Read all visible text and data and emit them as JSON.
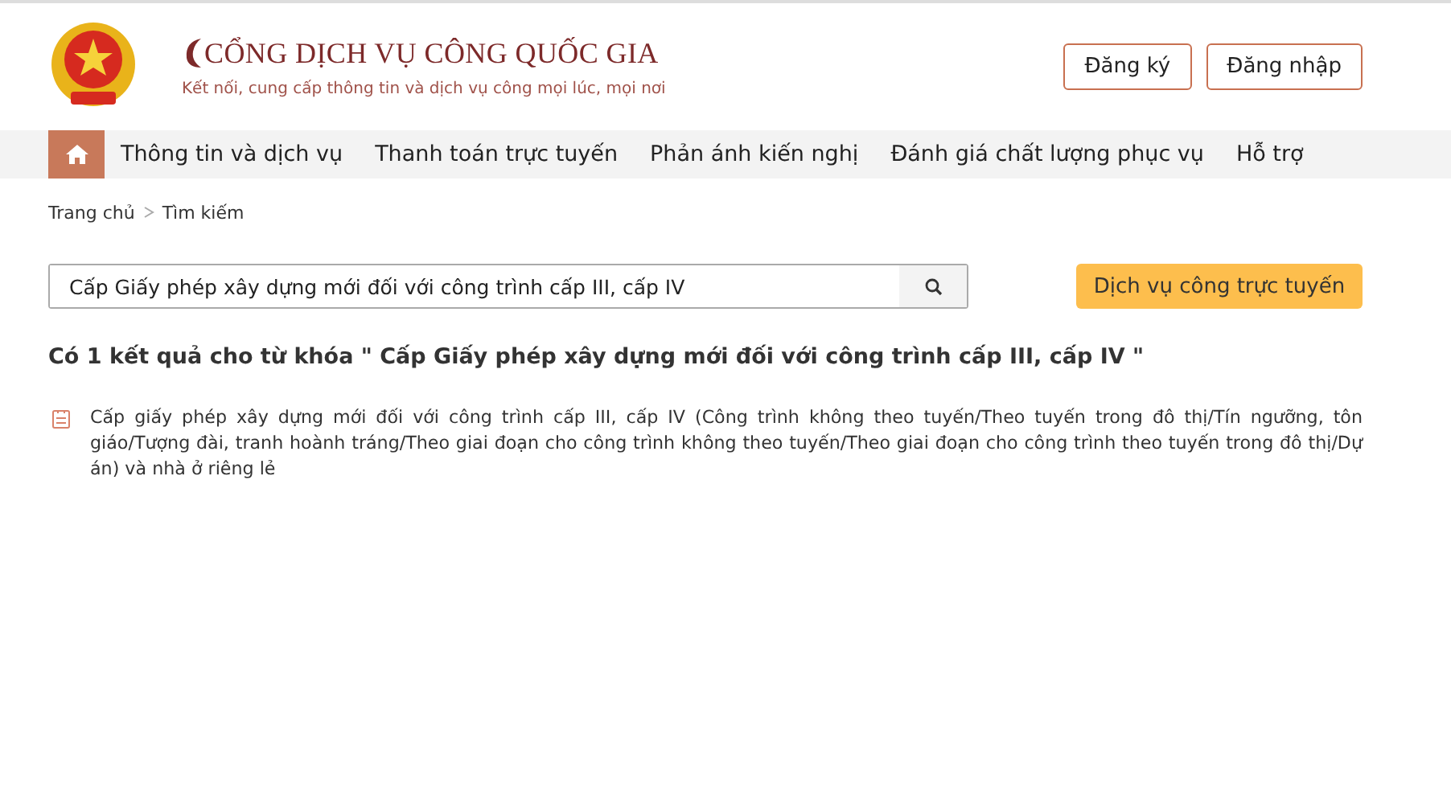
{
  "header": {
    "title": "CỔNG DỊCH VỤ CÔNG QUỐC GIA",
    "subtitle": "Kết nối, cung cấp thông tin và dịch vụ công mọi lúc, mọi nơi",
    "buttons": [
      "Đăng ký",
      "Đăng nhập"
    ]
  },
  "nav": {
    "items": [
      {
        "label": "Thông tin và dịch vụ"
      },
      {
        "label": "Thanh toán trực tuyến"
      },
      {
        "label": "Phản ánh kiến nghị"
      },
      {
        "label": "Đánh giá chất lượng phục vụ"
      },
      {
        "label": "Hỗ trợ"
      }
    ]
  },
  "breadcrumb": [
    "Trang chủ",
    "Tìm kiếm"
  ],
  "search": {
    "value": "Cấp Giấy phép xây dựng mới đối với công trình cấp III, cấp IV",
    "online_button": "Dịch vụ công trực tuyến"
  },
  "results": {
    "heading": "Có 1 kết quả cho từ khóa \" Cấp Giấy phép xây dựng mới đối với công trình cấp III, cấp IV \"",
    "items": [
      "Cấp giấy phép xây dựng mới đối với công trình cấp III, cấp IV (Công trình không theo tuyến/Theo tuyến trong đô thị/Tín ngưỡng, tôn giáo/Tượng đài, tranh hoành tráng/Theo giai đoạn cho công trình không theo tuyến/Theo giai đoạn cho công trình theo tuyến trong đô thị/Dự án) và nhà ở riêng lẻ"
    ]
  }
}
